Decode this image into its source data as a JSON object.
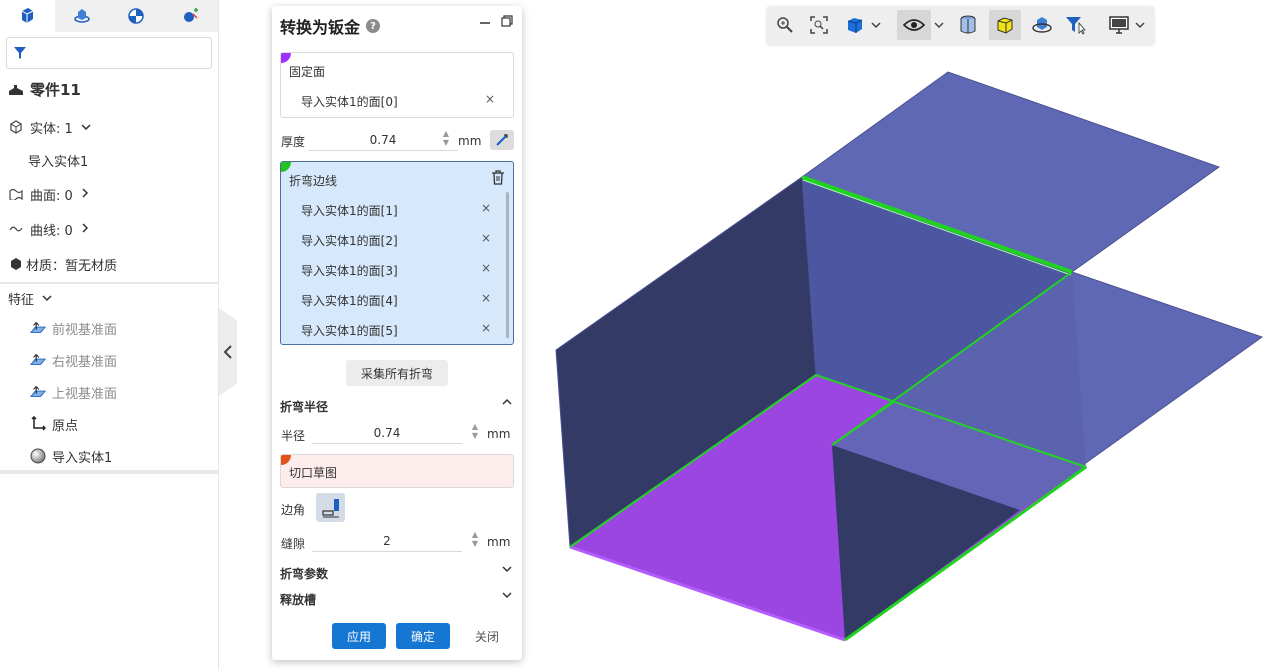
{
  "left_panel": {
    "tabs": [
      "part-tab-icon",
      "feature-tab-icon",
      "appearance-tab-icon",
      "analysis-tab-icon"
    ],
    "part_name": "零件11",
    "solids_label": "实体: 1",
    "solid_child": "导入实体1",
    "surfaces_label": "曲面: 0",
    "curves_label": "曲线: 0",
    "material_label": "材质：",
    "material_value": "暂无材质",
    "features_label": "特征",
    "features": [
      "前视基准面",
      "右视基准面",
      "上视基准面",
      "原点",
      "导入实体1"
    ]
  },
  "dialog": {
    "title": "转换为钣金",
    "fixed_face": {
      "label": "固定面",
      "items": [
        "导入实体1的面[0]"
      ]
    },
    "thickness": {
      "label": "厚度",
      "value": "0.74",
      "unit": "mm"
    },
    "bend_edges": {
      "label": "折弯边线",
      "items": [
        "导入实体1的面[1]",
        "导入实体1的面[2]",
        "导入实体1的面[3]",
        "导入实体1的面[4]",
        "导入实体1的面[5]"
      ]
    },
    "collect_bends_label": "采集所有折弯",
    "bend_radius_section": "折弯半径",
    "radius": {
      "label": "半径",
      "value": "0.74",
      "unit": "mm"
    },
    "cut_sketch_label": "切口草图",
    "corner_label": "边角",
    "gap": {
      "label": "缝隙",
      "value": "2",
      "unit": "mm"
    },
    "bend_params_section": "折弯参数",
    "relief_section": "释放槽",
    "apply_label": "应用",
    "ok_label": "确定",
    "close_label": "关闭",
    "colors": {
      "fixed_face": "#9b30ff",
      "bend_edges": "#22c422",
      "cut_sketch": "#e0531a",
      "primary": "#1677d2"
    }
  },
  "toolbar": {
    "tools": [
      "zoom-icon",
      "zoom-fit-icon",
      "view-cube-icon",
      "visibility-icon",
      "section-view-icon",
      "shaded-mode-icon",
      "rotate-view-icon",
      "selection-filter-icon",
      "display-icon"
    ]
  },
  "viewport": {
    "colors": {
      "panel": "#6068b5",
      "dark_panel": "#343a66",
      "selected_face": "#9b46e0",
      "edge_highlight": "#21d321"
    }
  }
}
